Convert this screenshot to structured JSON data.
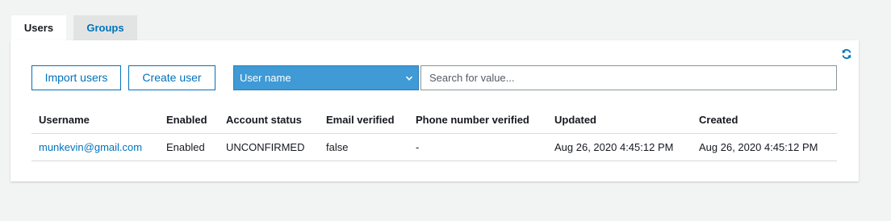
{
  "tabs": {
    "users": "Users",
    "groups": "Groups"
  },
  "toolbar": {
    "import_label": "Import users",
    "create_label": "Create user",
    "filter_selected": "User name",
    "search_placeholder": "Search for value..."
  },
  "icons": {
    "refresh": "refresh-icon",
    "dropdown": "chevron-down-icon"
  },
  "colors": {
    "accent": "#0073bb",
    "select_bg": "#3f9ad6"
  },
  "table": {
    "headers": [
      "Username",
      "Enabled",
      "Account status",
      "Email verified",
      "Phone number verified",
      "Updated",
      "Created"
    ],
    "rows": [
      [
        "munkevin@gmail.com",
        "Enabled",
        "UNCONFIRMED",
        "false",
        "-",
        "Aug 26, 2020 4:45:12 PM",
        "Aug 26, 2020 4:45:12 PM"
      ]
    ]
  }
}
